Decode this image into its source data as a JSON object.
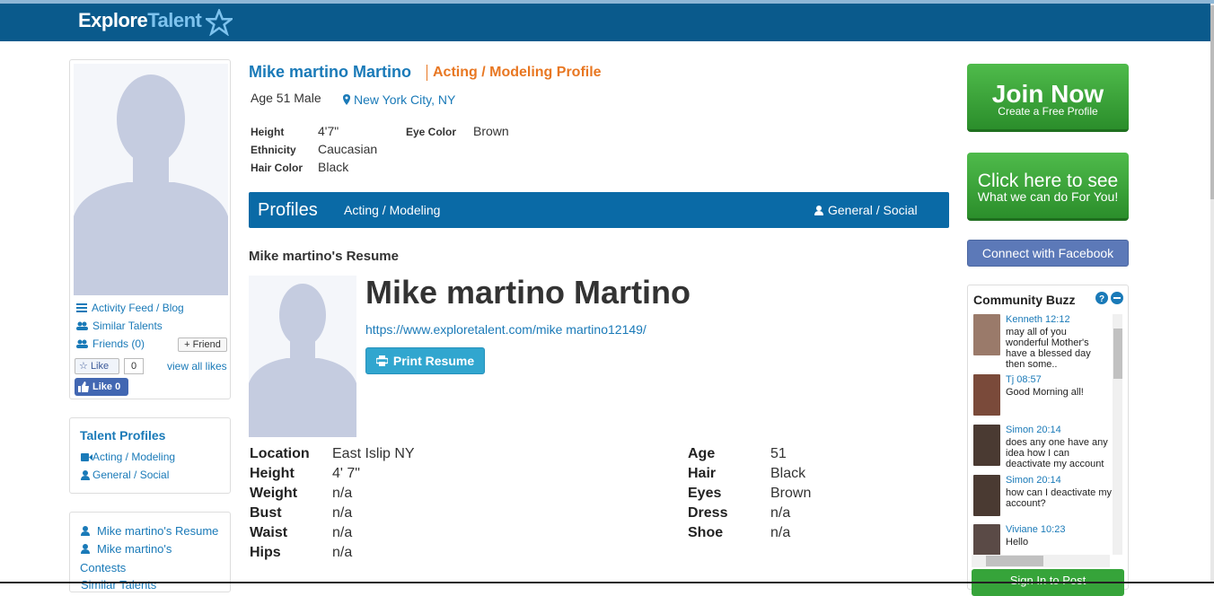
{
  "header": {
    "logo_explore": "Explore",
    "logo_talent": "Talent"
  },
  "left": {
    "links": [
      {
        "label": "Activity Feed / Blog",
        "icon": "list-icon"
      },
      {
        "label": "Similar Talents",
        "icon": "users-icon"
      },
      {
        "label": "Friends (0)",
        "icon": "users-icon"
      }
    ],
    "friend_button": "+ Friend",
    "like_label": "Like",
    "like_count": "0",
    "view_all_likes": "view all likes",
    "fb_like": "Like 0",
    "talent_profiles": {
      "title": "Talent Profiles",
      "items": [
        "Acting / Modeling",
        "General / Social"
      ]
    },
    "resume_links": [
      "Mike martino's Resume",
      "Mike martino's",
      "Contests",
      "Similar Talents"
    ]
  },
  "profile": {
    "name": "Mike martino Martino",
    "type": "Acting / Modeling Profile",
    "age_sex": "Age 51 Male",
    "location": "New York City, NY",
    "attrs": {
      "height_label": "Height",
      "height": "4'7\"",
      "ethnicity_label": "Ethnicity",
      "ethnicity": "Caucasian",
      "hair_label": "Hair Color",
      "hair": "Black",
      "eye_label": "Eye Color",
      "eye": "Brown"
    }
  },
  "profiles_bar": {
    "title": "Profiles",
    "tab_acting": "Acting / Modeling",
    "tab_general": "General / Social"
  },
  "resume": {
    "heading": "Mike martino's Resume",
    "big_name": "Mike martino Martino",
    "url": "https://www.exploretalent.com/mike martino12149/",
    "print_label": "Print Resume",
    "stats_left": [
      {
        "k": "Location",
        "v": "East Islip NY"
      },
      {
        "k": "Height",
        "v": "4' 7\""
      },
      {
        "k": "Weight",
        "v": "n/a"
      },
      {
        "k": "Bust",
        "v": "n/a"
      },
      {
        "k": "Waist",
        "v": "n/a"
      },
      {
        "k": "Hips",
        "v": "n/a"
      }
    ],
    "stats_right": [
      {
        "k": "Age",
        "v": "51"
      },
      {
        "k": "Hair",
        "v": "Black"
      },
      {
        "k": "Eyes",
        "v": "Brown"
      },
      {
        "k": "Dress",
        "v": "n/a"
      },
      {
        "k": "Shoe",
        "v": "n/a"
      }
    ]
  },
  "right": {
    "join_big": "Join Now",
    "join_small": "Create a Free Profile",
    "see_big": "Click here to see",
    "see_small": "What we can do For You!",
    "facebook": "Connect with Facebook",
    "buzz_title": "Community Buzz",
    "buzz": [
      {
        "who": "Kenneth 12:12",
        "msg": "may all of you wonderful Mother's have a blessed day then some..",
        "color": "#9a7a6a"
      },
      {
        "who": "Tj 08:57",
        "msg": "Good Morning all!",
        "color": "#7a4a3a"
      },
      {
        "who": "Simon 20:14",
        "msg": "does any one have any idea how I can deactivate my account",
        "color": "#4a3a32"
      },
      {
        "who": "Simon 20:14",
        "msg": "how can I deactivate my account?",
        "color": "#4a3a32"
      },
      {
        "who": "Viviane 10:23",
        "msg": "Hello",
        "color": "#5a4a46"
      }
    ],
    "signin": "Sign In to Post"
  }
}
